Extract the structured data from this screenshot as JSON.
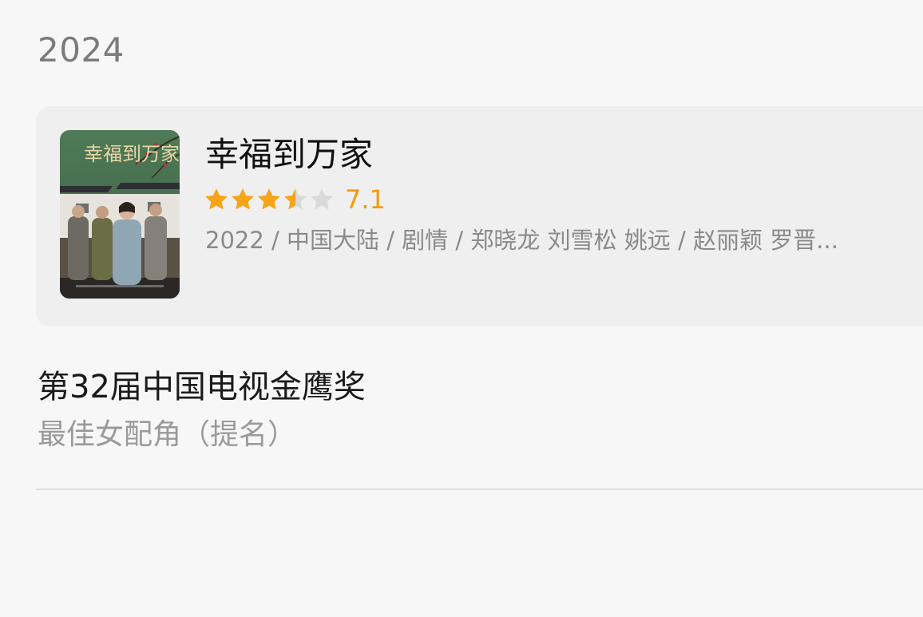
{
  "year": "2024",
  "work": {
    "title": "幸福到万家",
    "rating": 7.1,
    "rating_text": "7.1",
    "stars": 3.5,
    "meta": "2022 / 中国大陆 / 剧情 / 郑晓龙 刘雪松 姚远 / 赵丽颖 罗晋...",
    "poster": {
      "title_text": "幸福到万家",
      "icon": "poster-image"
    }
  },
  "award": {
    "name": "第32届中国电视金鹰奖",
    "category": "最佳女配角（提名）"
  },
  "colors": {
    "star_filled": "#f7a417",
    "star_empty": "#d9d9d9",
    "score": "#f39a0f"
  }
}
